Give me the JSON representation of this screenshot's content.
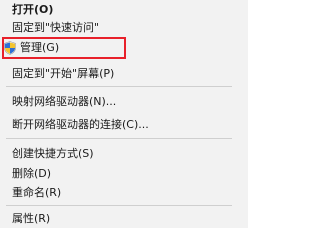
{
  "context_menu": {
    "items": {
      "open": "打开(O)",
      "pin_quick_access": "固定到\"快速访问\"",
      "manage": "管理(G)",
      "pin_start": "固定到\"开始\"屏幕(P)",
      "map_drive": "映射网络驱动器(N)...",
      "disconnect_drive": "断开网络驱动器的连接(C)...",
      "create_shortcut": "创建快捷方式(S)",
      "delete": "删除(D)",
      "rename": "重命名(R)",
      "properties": "属性(R)"
    },
    "manage_icon": "uac-shield-icon",
    "highlight_color": "#e8202a"
  }
}
